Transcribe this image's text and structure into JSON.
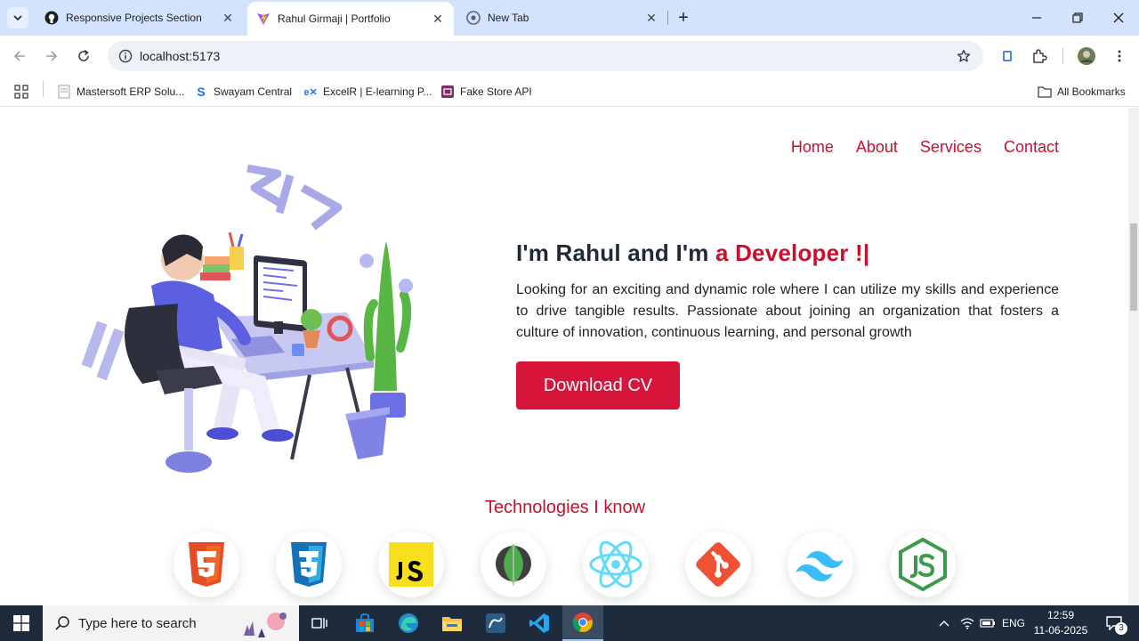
{
  "browser": {
    "tabs": [
      {
        "title": "Responsive Projects Section",
        "active": false
      },
      {
        "title": "Rahul Girmaji | Portfolio",
        "active": true
      },
      {
        "title": "New Tab",
        "active": false
      }
    ],
    "url": "localhost:5173",
    "bookmarks": [
      {
        "label": "Mastersoft ERP Solu...",
        "icon": "document-icon"
      },
      {
        "label": "Swayam Central",
        "icon": "swayam-logo-icon"
      },
      {
        "label": "ExcelR | E-learning P...",
        "icon": "excelr-logo-icon"
      },
      {
        "label": "Fake Store API",
        "icon": "fakestore-logo-icon"
      }
    ],
    "all_bookmarks": "All Bookmarks"
  },
  "page": {
    "nav": [
      "Home",
      "About",
      "Services",
      "Contact"
    ],
    "hero": {
      "title_prefix": "I'm Rahul and I'm ",
      "title_accent": "a Developer !|",
      "description": "Looking for an exciting and dynamic role where I can utilize my skills and experience to drive tangible results. Passionate about joining an organization that fosters a culture of innovation, continuous learning, and personal growth",
      "cta": "Download CV"
    },
    "technologies_title": "Technologies I know",
    "technologies": [
      "html5-icon",
      "css3-icon",
      "javascript-icon",
      "mongodb-icon",
      "react-icon",
      "git-icon",
      "tailwind-icon",
      "nodejs-icon"
    ]
  },
  "taskbar": {
    "search_placeholder": "Type here to search",
    "language": "ENG",
    "time": "12:59",
    "date": "11-06-2025",
    "notifications": "3"
  },
  "colors": {
    "accent": "#c8102e",
    "button": "#d7153a",
    "tabstrip": "#d3e3fd",
    "taskbar": "#1e2b3c"
  }
}
